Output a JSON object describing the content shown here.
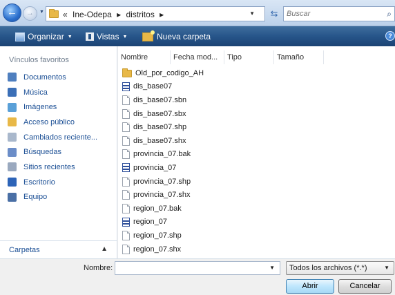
{
  "address": {
    "crumbs": [
      "«",
      "Ine-Odepa",
      "▸",
      "distritos",
      "▸"
    ],
    "search_placeholder": "Buscar"
  },
  "toolbar": {
    "organize": "Organizar",
    "views": "Vistas",
    "new_folder": "Nueva carpeta",
    "help": "?"
  },
  "sidebar": {
    "title": "Vínculos favoritos",
    "items": [
      {
        "label": "Documentos",
        "icon": "documents-icon",
        "color": "#4f7fbf"
      },
      {
        "label": "Música",
        "icon": "music-icon",
        "color": "#3b6fb7"
      },
      {
        "label": "Imágenes",
        "icon": "pictures-icon",
        "color": "#5aa0d8"
      },
      {
        "label": "Acceso público",
        "icon": "public-folder-icon",
        "color": "#e8b847"
      },
      {
        "label": "Cambiados reciente...",
        "icon": "recently-changed-icon",
        "color": "#a9b8cc"
      },
      {
        "label": "Búsquedas",
        "icon": "searches-icon",
        "color": "#6b8dc8"
      },
      {
        "label": "Sitios recientes",
        "icon": "recent-places-icon",
        "color": "#9aa9bf"
      },
      {
        "label": "Escritorio",
        "icon": "desktop-icon",
        "color": "#2d64b8"
      },
      {
        "label": "Equipo",
        "icon": "computer-icon",
        "color": "#4a6fa5"
      }
    ],
    "folders_label": "Carpetas"
  },
  "columns": {
    "name": "Nombre",
    "date": "Fecha mod...",
    "type": "Tipo",
    "size": "Tamaño"
  },
  "files": [
    {
      "name": "Old_por_codigo_AH",
      "icon": "folder"
    },
    {
      "name": "dis_base07",
      "icon": "db"
    },
    {
      "name": "dis_base07.sbn",
      "icon": "doc"
    },
    {
      "name": "dis_base07.sbx",
      "icon": "doc"
    },
    {
      "name": "dis_base07.shp",
      "icon": "doc"
    },
    {
      "name": "dis_base07.shx",
      "icon": "doc"
    },
    {
      "name": "provincia_07.bak",
      "icon": "doc"
    },
    {
      "name": "provincia_07",
      "icon": "db"
    },
    {
      "name": "provincia_07.shp",
      "icon": "doc"
    },
    {
      "name": "provincia_07.shx",
      "icon": "doc"
    },
    {
      "name": "region_07.bak",
      "icon": "doc"
    },
    {
      "name": "region_07",
      "icon": "db"
    },
    {
      "name": "region_07.shp",
      "icon": "doc"
    },
    {
      "name": "region_07.shx",
      "icon": "doc"
    }
  ],
  "footer": {
    "name_label": "Nombre:",
    "name_value": "",
    "file_type": "Todos los archivos (*.*)",
    "open": "Abrir",
    "cancel": "Cancelar"
  }
}
